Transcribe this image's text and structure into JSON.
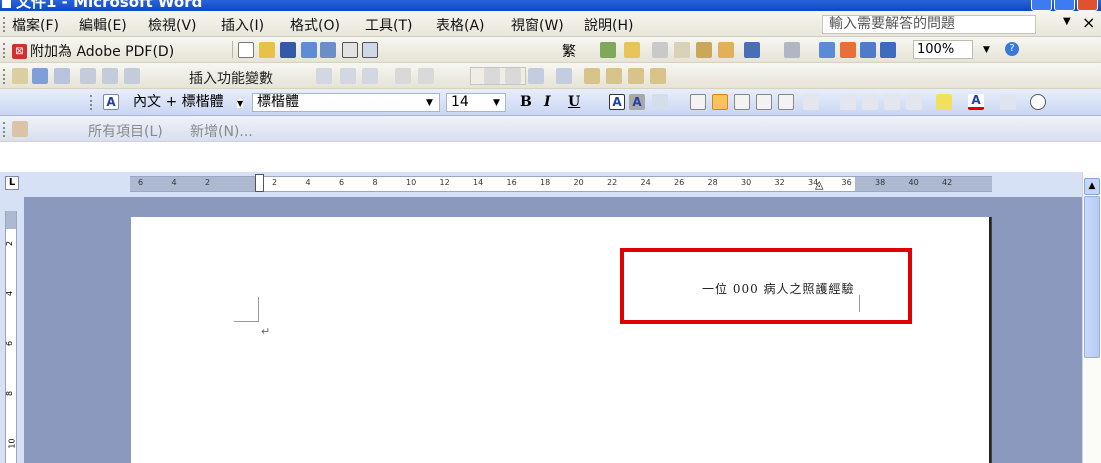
{
  "window": {
    "title": "文件1 - Microsoft Word"
  },
  "menu": {
    "items": [
      "檔案(F)",
      "編輯(E)",
      "檢視(V)",
      "插入(I)",
      "格式(O)",
      "工具(T)",
      "表格(A)",
      "視窗(W)",
      "說明(H)"
    ],
    "help_placeholder": "輸入需要解答的問題"
  },
  "toolbar_standard": {
    "pdf_label": "附加為 Adobe PDF(D)",
    "traditional": "繁",
    "zoom": "100%"
  },
  "toolbar_mailmerge": {
    "insert_field_label": "插入功能變數"
  },
  "toolbar_format": {
    "style": "內文 + 標楷體",
    "font": "標楷體",
    "size": "14",
    "bold": "B",
    "italic": "I",
    "underline": "U"
  },
  "toolbar_clipart": {
    "all_items": "所有項目(L)",
    "new_item": "新增(N)..."
  },
  "ruler": {
    "ticks": [
      "6",
      "4",
      "2",
      "",
      "2",
      "4",
      "6",
      "8",
      "10",
      "12",
      "14",
      "16",
      "18",
      "20",
      "22",
      "24",
      "26",
      "28",
      "30",
      "32",
      "34",
      "36",
      "38",
      "40",
      "42"
    ],
    "vticks": [
      "2",
      "4",
      "6",
      "8",
      "10"
    ]
  },
  "document": {
    "header_text": "一位 000 病人之照護經驗",
    "paragraph_mark": "↵"
  }
}
